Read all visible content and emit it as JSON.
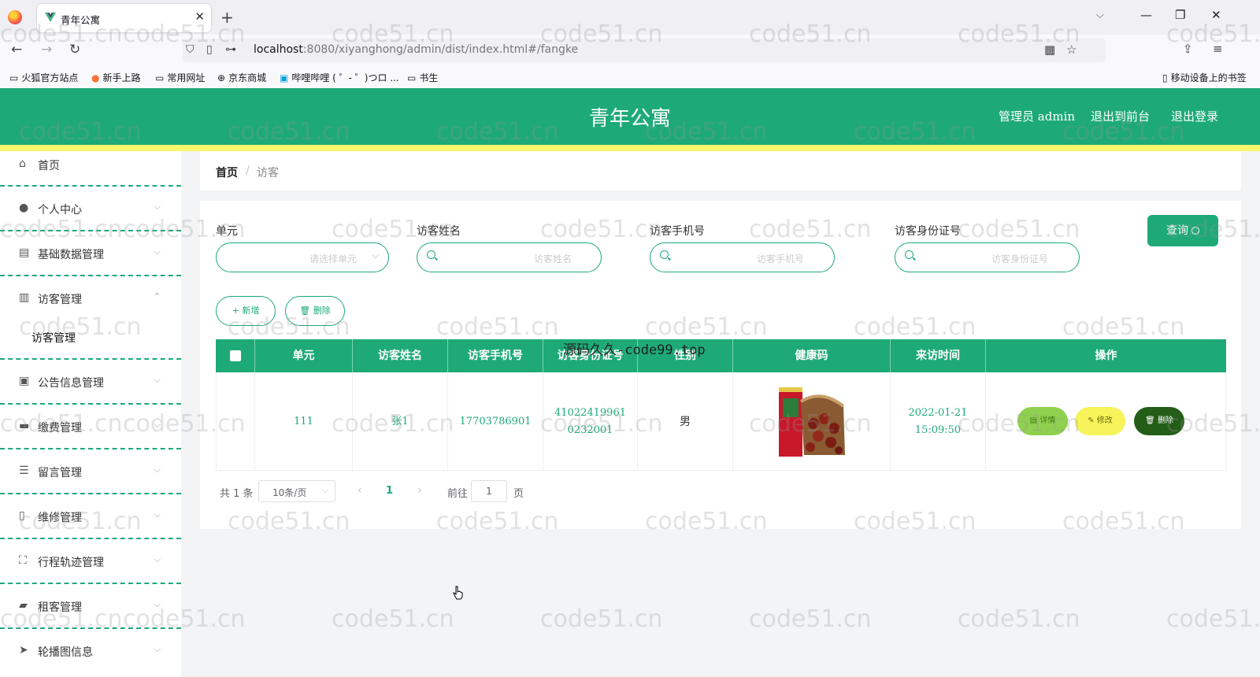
{
  "browser": {
    "tab_title": "青年公寓",
    "url_host": "localhost",
    "url_rest": ":8080/xiyanghong/admin/dist/index.html#/fangke",
    "bookmarks": [
      "火狐官方站点",
      "新手上路",
      "常用网址",
      "京东商城",
      "哔哩哔哩 ( ゜- ゜)つロ ...",
      "书生"
    ],
    "mobile_bookmarks": "移动设备上的书签"
  },
  "header": {
    "title": "青年公寓",
    "admin_prefix": "管理员",
    "admin_name": "admin",
    "to_front": "退出到前台",
    "logout": "退出登录",
    "color": "#1eaa77",
    "stripe_color": "#f9f76b"
  },
  "sidebar": {
    "items": [
      {
        "label": "首页",
        "icon": "home-icon"
      },
      {
        "label": "个人中心",
        "icon": "user-icon"
      },
      {
        "label": "基础数据管理",
        "icon": "database-icon"
      },
      {
        "label": "访客管理",
        "icon": "clipboard-icon"
      },
      {
        "label": "公告信息管理",
        "icon": "notice-icon"
      },
      {
        "label": "缴费管理",
        "icon": "payment-icon"
      },
      {
        "label": "留言管理",
        "icon": "sliders-icon"
      },
      {
        "label": "维修管理",
        "icon": "tool-icon"
      },
      {
        "label": "行程轨迹管理",
        "icon": "scan-icon"
      },
      {
        "label": "租客管理",
        "icon": "ticket-icon"
      },
      {
        "label": "轮播图信息",
        "icon": "send-icon"
      }
    ],
    "submenu": "访客管理"
  },
  "breadcrumb": {
    "home": "首页",
    "sep": "/",
    "current": "访客"
  },
  "filters": {
    "unit_label": "单元",
    "unit_placeholder": "请选择单元",
    "name_label": "访客姓名",
    "name_placeholder": "访客姓名",
    "phone_label": "访客手机号",
    "phone_placeholder": "访客手机号",
    "id_label": "访客身份证号",
    "id_placeholder": "访客身份证号",
    "query_button": "查询"
  },
  "actions": {
    "add": "+ 新增",
    "delete": "删除"
  },
  "table": {
    "columns": [
      "单元",
      "访客姓名",
      "访客手机号",
      "访客身份证号",
      "性别",
      "健康码",
      "来访时间",
      "操作"
    ],
    "rows": [
      {
        "unit": "111",
        "name": "张1",
        "phone": "17703786901",
        "id_number": "410224199610232001",
        "gender": "男",
        "visit_time": "2022-01-21 15:09:50",
        "ops": {
          "detail": "详情",
          "edit": "修改",
          "delete": "删除"
        }
      }
    ]
  },
  "pagination": {
    "total": "共 1 条",
    "page_size": "10条/页",
    "current_page": "1",
    "goto_prefix": "前往",
    "goto_value": "1",
    "goto_suffix": "页"
  },
  "watermark": {
    "text": "code51.cn",
    "center_text": "源码久久-code99.top"
  }
}
